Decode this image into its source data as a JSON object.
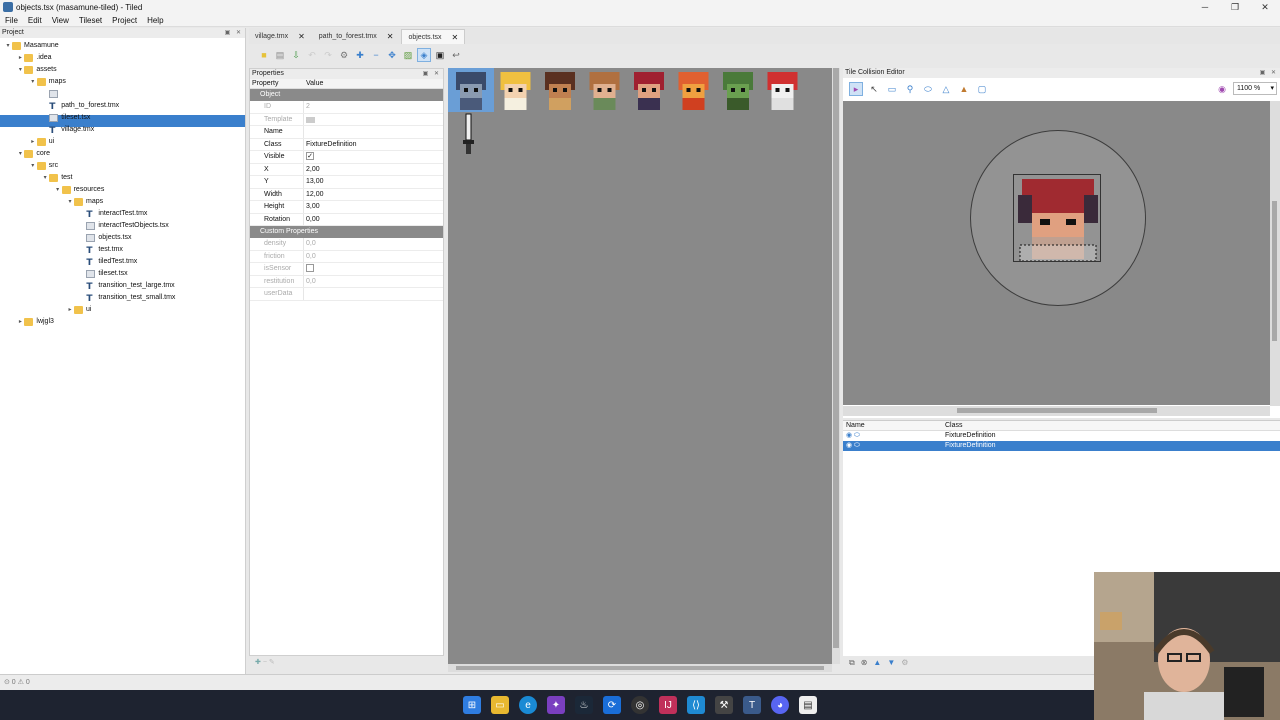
{
  "window": {
    "title": "objects.tsx (masamune-tiled) - Tiled",
    "controls": [
      "─",
      "❐",
      "✕"
    ]
  },
  "menu": [
    "File",
    "Edit",
    "View",
    "Tileset",
    "Project",
    "Help"
  ],
  "project_panel": {
    "title": "Project",
    "tree": [
      {
        "label": "Masamune",
        "icon": "folder",
        "indent": 0,
        "arrow": "▾"
      },
      {
        "label": ".idea",
        "icon": "folder",
        "indent": 1,
        "arrow": "▸"
      },
      {
        "label": "assets",
        "icon": "folder",
        "indent": 1,
        "arrow": "▾"
      },
      {
        "label": "maps",
        "icon": "folder",
        "indent": 2,
        "arrow": "▾"
      },
      {
        "label": "objects.tsx",
        "icon": "tsx",
        "indent": 3,
        "arrow": "",
        "selected": true
      },
      {
        "label": "path_to_forest.tmx",
        "icon": "tmx",
        "indent": 3,
        "arrow": ""
      },
      {
        "label": "tileset.tsx",
        "icon": "tsx",
        "indent": 3,
        "arrow": ""
      },
      {
        "label": "village.tmx",
        "icon": "tmx",
        "indent": 3,
        "arrow": ""
      },
      {
        "label": "ui",
        "icon": "folder",
        "indent": 2,
        "arrow": "▸"
      },
      {
        "label": "core",
        "icon": "folder",
        "indent": 1,
        "arrow": "▾"
      },
      {
        "label": "src",
        "icon": "folder",
        "indent": 2,
        "arrow": "▾"
      },
      {
        "label": "test",
        "icon": "folder",
        "indent": 3,
        "arrow": "▾"
      },
      {
        "label": "resources",
        "icon": "folder",
        "indent": 4,
        "arrow": "▾"
      },
      {
        "label": "maps",
        "icon": "folder",
        "indent": 5,
        "arrow": "▾"
      },
      {
        "label": "interactTest.tmx",
        "icon": "tmx",
        "indent": 6,
        "arrow": ""
      },
      {
        "label": "interactTestObjects.tsx",
        "icon": "tsx",
        "indent": 6,
        "arrow": ""
      },
      {
        "label": "objects.tsx",
        "icon": "tsx",
        "indent": 6,
        "arrow": ""
      },
      {
        "label": "test.tmx",
        "icon": "tmx",
        "indent": 6,
        "arrow": ""
      },
      {
        "label": "tiledTest.tmx",
        "icon": "tmx",
        "indent": 6,
        "arrow": ""
      },
      {
        "label": "tileset.tsx",
        "icon": "tsx",
        "indent": 6,
        "arrow": ""
      },
      {
        "label": "transition_test_large.tmx",
        "icon": "tmx",
        "indent": 6,
        "arrow": ""
      },
      {
        "label": "transition_test_small.tmx",
        "icon": "tmx",
        "indent": 6,
        "arrow": ""
      },
      {
        "label": "ui",
        "icon": "folder",
        "indent": 5,
        "arrow": "▸"
      },
      {
        "label": "lwjgl3",
        "icon": "folder",
        "indent": 1,
        "arrow": "▸"
      }
    ]
  },
  "tabs": [
    {
      "label": "village.tmx",
      "active": false
    },
    {
      "label": "path_to_forest.tmx",
      "active": false
    },
    {
      "label": "objects.tsx",
      "active": true
    }
  ],
  "properties_panel": {
    "title": "Properties",
    "col_property": "Property",
    "col_value": "Value",
    "group_object": "Object",
    "object_rows": [
      {
        "key": "ID",
        "value": "2",
        "dim": true
      },
      {
        "key": "Template",
        "value": "",
        "dim": true
      },
      {
        "key": "Name",
        "value": "",
        "dim": false
      },
      {
        "key": "Class",
        "value": "FixtureDefinition",
        "dim": false
      },
      {
        "key": "Visible",
        "value": "✓",
        "dim": false,
        "checkbox": true
      },
      {
        "key": "X",
        "value": "2,00",
        "dim": false
      },
      {
        "key": "Y",
        "value": "13,00",
        "dim": false
      },
      {
        "key": "Width",
        "value": "12,00",
        "dim": false
      },
      {
        "key": "Height",
        "value": "3,00",
        "dim": false
      },
      {
        "key": "Rotation",
        "value": "0,00",
        "dim": false
      }
    ],
    "group_custom": "Custom Properties",
    "custom_rows": [
      {
        "key": "density",
        "value": "0,0"
      },
      {
        "key": "friction",
        "value": "0,0"
      },
      {
        "key": "isSensor",
        "value": "",
        "checkbox": true
      },
      {
        "key": "restitution",
        "value": "0,0"
      },
      {
        "key": "userData",
        "value": ""
      }
    ]
  },
  "collision_editor": {
    "title": "Tile Collision Editor",
    "zoom": "1100 %"
  },
  "objects_list": {
    "col_name": "Name",
    "col_class": "Class",
    "rows": [
      {
        "name": "",
        "class": "FixtureDefinition",
        "selected": false
      },
      {
        "name": "",
        "class": "FixtureDefinition",
        "selected": true
      }
    ]
  },
  "statusbar": {
    "text": "⊙ 0 ⚠ 0"
  },
  "colors": {
    "accent": "#3a7fcc",
    "canvas": "#898989"
  }
}
